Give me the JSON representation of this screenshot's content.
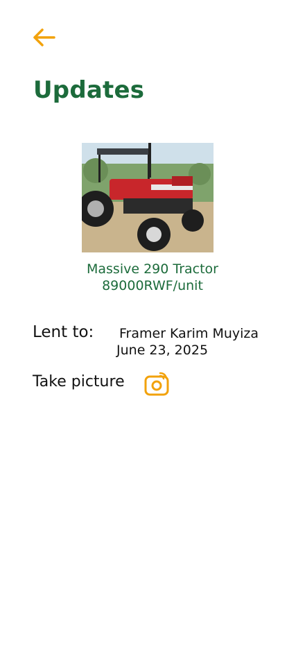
{
  "header": {
    "back_icon": "arrow-left-icon",
    "title": "Updates"
  },
  "product": {
    "image_subject": "red tractor",
    "name": "Massive 290 Tractor",
    "price": "89000RWF/unit"
  },
  "lending": {
    "label": "Lent to:",
    "borrower": "Framer Karim Muyiza",
    "date": "June 23, 2025"
  },
  "actions": {
    "take_picture_label": "Take picture",
    "camera_icon": "camera-icon"
  },
  "colors": {
    "accent": "#f2a20c",
    "title_green": "#1c6b3b",
    "text": "#111111"
  }
}
